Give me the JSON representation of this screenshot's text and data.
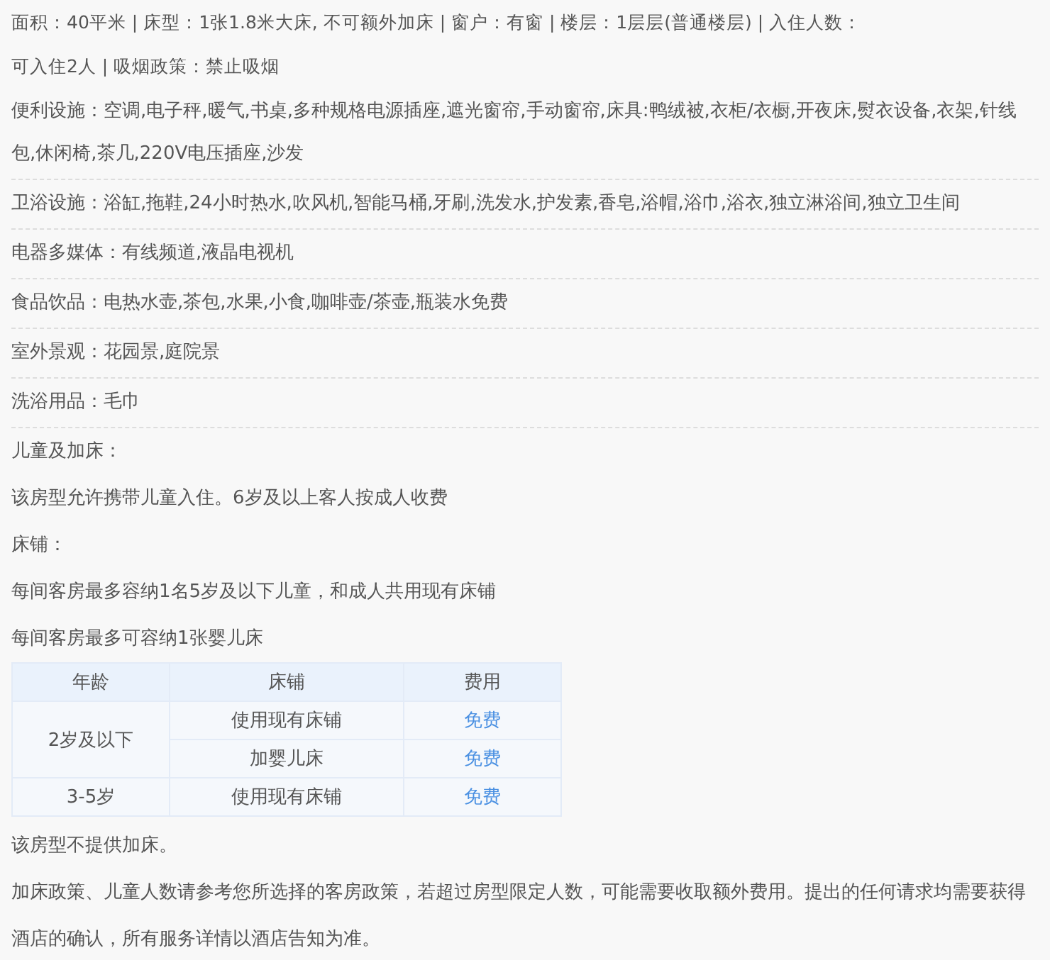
{
  "summary_lines": [
    "面积：40平米 | 床型：1张1.8米大床, 不可额外加床 | 窗户：有窗 | 楼层：1层层(普通楼层) | 入住人数：",
    "可入住2人 | 吸烟政策：禁止吸烟"
  ],
  "facilities": [
    {
      "text": "便利设施：空调,电子秤,暖气,书桌,多种规格电源插座,遮光窗帘,手动窗帘,床具:鸭绒被,衣柜/衣橱,开夜床,熨衣设备,衣架,针线包,休闲椅,茶几,220V电压插座,沙发"
    },
    {
      "text": "卫浴设施：浴缸,拖鞋,24小时热水,吹风机,智能马桶,牙刷,洗发水,护发素,香皂,浴帽,浴巾,浴衣,独立淋浴间,独立卫生间"
    },
    {
      "text": "电器多媒体：有线频道,液晶电视机"
    },
    {
      "text": "食品饮品：电热水壶,茶包,水果,小食,咖啡壶/茶壶,瓶装水免费"
    },
    {
      "text": "室外景观：花园景,庭院景"
    },
    {
      "text": "洗浴用品：毛巾"
    }
  ],
  "children_policy": {
    "title": "儿童及加床：",
    "note": "该房型允许携带儿童入住。6岁及以上客人按成人收费",
    "bed_title": "床铺：",
    "rules": [
      "每间客房最多容纳1名5岁及以下儿童，和成人共用现有床铺",
      "每间客房最多可容纳1张婴儿床"
    ],
    "table": {
      "columns": [
        "年龄",
        "床铺",
        "费用"
      ],
      "rows": [
        {
          "age": "2岁及以下",
          "options": [
            {
              "bed": "使用现有床铺",
              "fee": "免费"
            },
            {
              "bed": "加婴儿床",
              "fee": "免费"
            }
          ]
        },
        {
          "age": "3-5岁",
          "options": [
            {
              "bed": "使用现有床铺",
              "fee": "免费"
            }
          ]
        }
      ]
    }
  },
  "extra_bed_note": "该房型不提供加床。",
  "disclaimer": "加床政策、儿童人数请参考您所选择的客房政策，若超过房型限定人数，可能需要收取额外费用。提出的任何请求均需要获得酒店的确认，所有服务详情以酒店告知为准。"
}
